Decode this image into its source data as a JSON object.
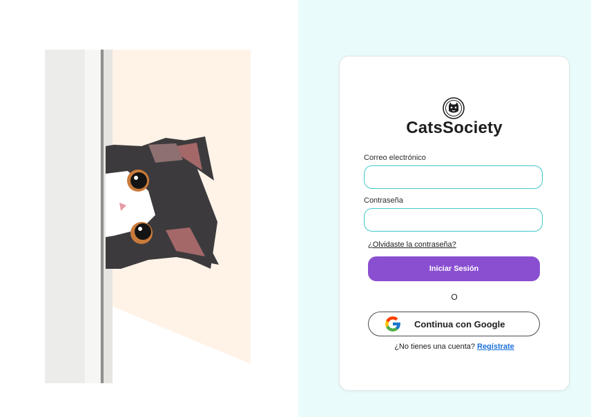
{
  "brand": {
    "name": "CatsSociety",
    "logo_icon": "cat-face-icon"
  },
  "form": {
    "email_label": "Correo electrónico",
    "email_value": "",
    "email_placeholder": "",
    "password_label": "Contraseña",
    "password_value": "",
    "password_placeholder": "",
    "forgot_link": "¿Olvidaste la contraseña?",
    "login_button": "Iniciar Sesión",
    "or_separator": "O",
    "google_button": "Continua con Google",
    "google_icon": "google-g-icon",
    "signup_prompt": "¿No tienes una cuenta?",
    "signup_link": "Regístrate"
  },
  "illustration": {
    "subject": "cat-peeking-icon"
  },
  "colors": {
    "right_panel_bg": "#e9fcfb",
    "input_border": "#3ec8c8",
    "primary_button": "#8a4fd0",
    "link": "#1a6fd8",
    "illustration_bg": "#fff3e8"
  }
}
